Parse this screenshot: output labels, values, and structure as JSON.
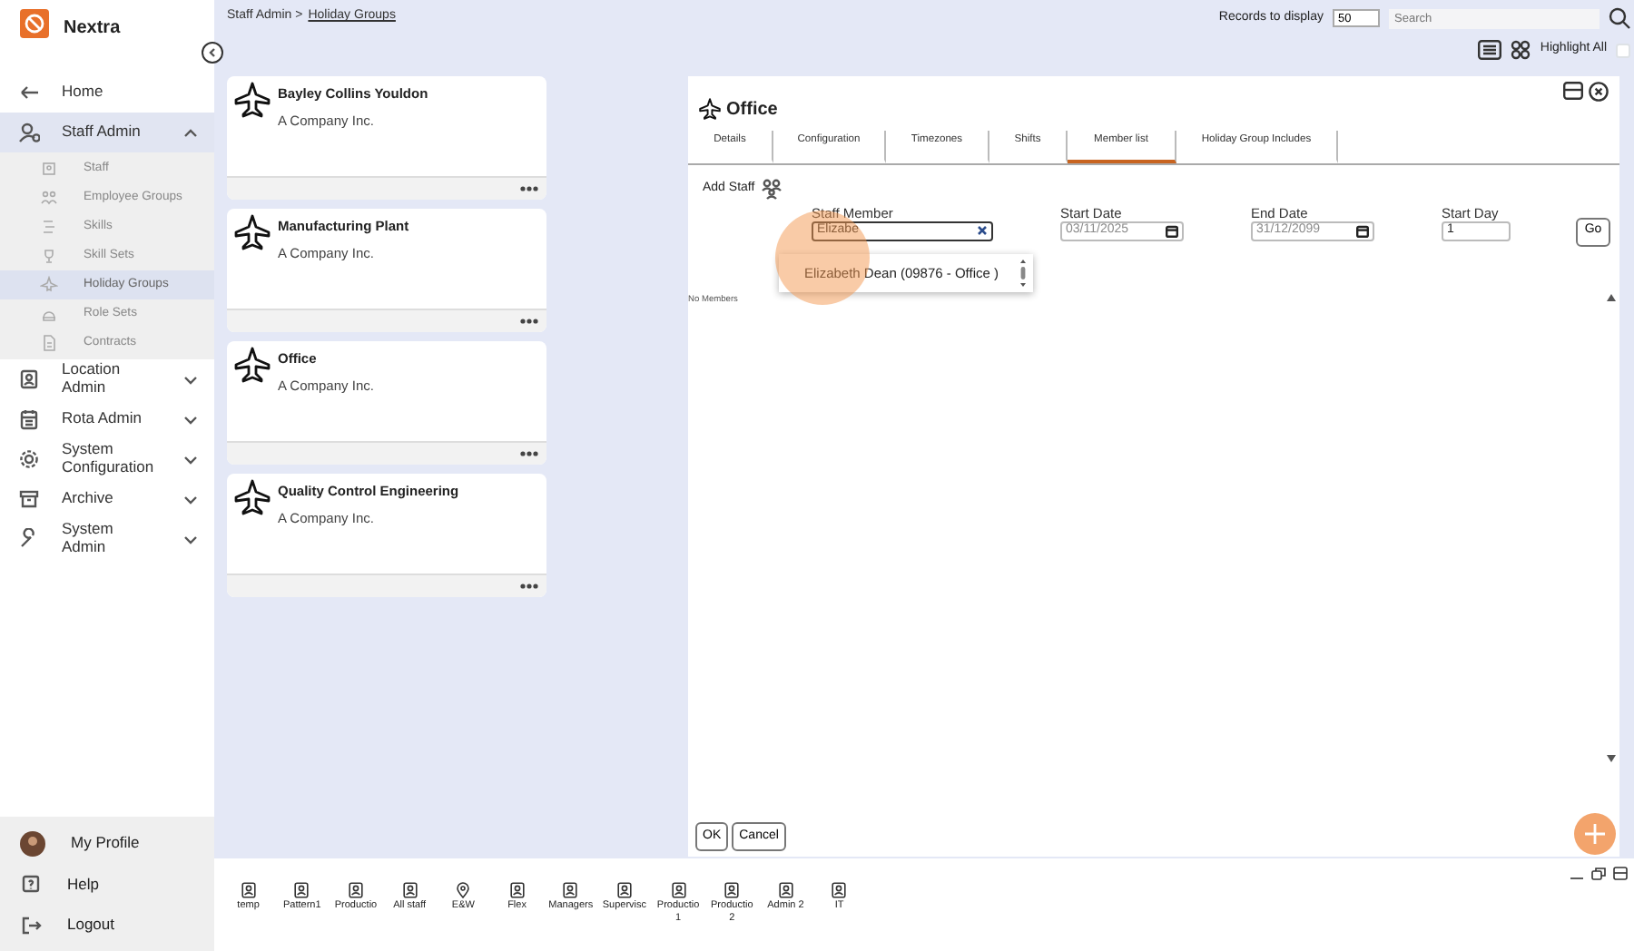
{
  "app": {
    "name": "Nextra"
  },
  "sidebar": {
    "items": [
      {
        "label": "Home",
        "kind": "link"
      },
      {
        "label": "Staff Admin",
        "kind": "group",
        "expanded": true,
        "children": [
          {
            "label": "Staff",
            "selected": false
          },
          {
            "label": "Employee Groups",
            "selected": false
          },
          {
            "label": "Skills",
            "selected": false
          },
          {
            "label": "Skill Sets",
            "selected": false
          },
          {
            "label": "Holiday Groups",
            "selected": true
          },
          {
            "label": "Role Sets",
            "selected": false
          },
          {
            "label": "Contracts",
            "selected": false
          }
        ]
      },
      {
        "label": "Location Admin",
        "kind": "group",
        "expanded": false
      },
      {
        "label": "Rota Admin",
        "kind": "group",
        "expanded": false
      },
      {
        "label": "System Configuration",
        "kind": "group",
        "expanded": false
      },
      {
        "label": "Archive",
        "kind": "group",
        "expanded": false
      },
      {
        "label": "System Admin",
        "kind": "group",
        "expanded": false
      }
    ],
    "footer": [
      {
        "label": "My Profile",
        "kind": "profile"
      },
      {
        "label": "Help",
        "kind": "help"
      },
      {
        "label": "Logout",
        "kind": "logout"
      }
    ]
  },
  "breadcrumb": {
    "parent": "Staff Admin >",
    "current": "Holiday Groups"
  },
  "toolbar": {
    "records_label": "Records to display",
    "records_value": "50",
    "search_placeholder": "Search",
    "highlight_label": "Highlight All",
    "highlight_checked": false
  },
  "cards": [
    {
      "title": "Bayley Collins Youldon",
      "subtitle": "A Company Inc."
    },
    {
      "title": "Manufacturing Plant",
      "subtitle": "A Company Inc."
    },
    {
      "title": "Office",
      "subtitle": "A Company Inc."
    },
    {
      "title": "Quality Control Engineering",
      "subtitle": "A Company Inc."
    }
  ],
  "panel": {
    "title": "Office",
    "tabs": [
      {
        "label": "Details",
        "selected": false
      },
      {
        "label": "Configuration",
        "selected": false
      },
      {
        "label": "Timezones",
        "selected": false
      },
      {
        "label": "Shifts",
        "selected": false
      },
      {
        "label": "Member list",
        "selected": true
      },
      {
        "label": "Holiday Group Includes",
        "selected": false
      }
    ],
    "add_staff_label": "Add Staff",
    "fields": [
      {
        "label": "Staff Member",
        "kind": "lookup",
        "value": "Elizabe"
      },
      {
        "label": "Start Date",
        "kind": "date",
        "value": "03/11/2025"
      },
      {
        "label": "End Date",
        "kind": "date",
        "value": "31/12/2099"
      },
      {
        "label": "Start Day",
        "kind": "number",
        "value": "1"
      }
    ],
    "go_button": "Go",
    "suggestions": [
      {
        "text": "Elizabeth Dean (09876 - Office )"
      }
    ],
    "empty_text": "No Members",
    "buttons": [
      "OK",
      "Cancel"
    ]
  },
  "shortcuts": [
    {
      "label": "temp",
      "kind": "person"
    },
    {
      "label": "Pattern1",
      "kind": "person"
    },
    {
      "label": "Productio",
      "kind": "person"
    },
    {
      "label": "All staff",
      "kind": "person"
    },
    {
      "label": "E&W",
      "kind": "location"
    },
    {
      "label": "Flex",
      "kind": "person"
    },
    {
      "label": "Managers",
      "kind": "person"
    },
    {
      "label": "Supervisc",
      "kind": "person"
    },
    {
      "label": "Productio 1",
      "kind": "person"
    },
    {
      "label": "Productio 2",
      "kind": "person"
    },
    {
      "label": "Admin 2",
      "kind": "person"
    },
    {
      "label": "IT",
      "kind": "person"
    }
  ]
}
